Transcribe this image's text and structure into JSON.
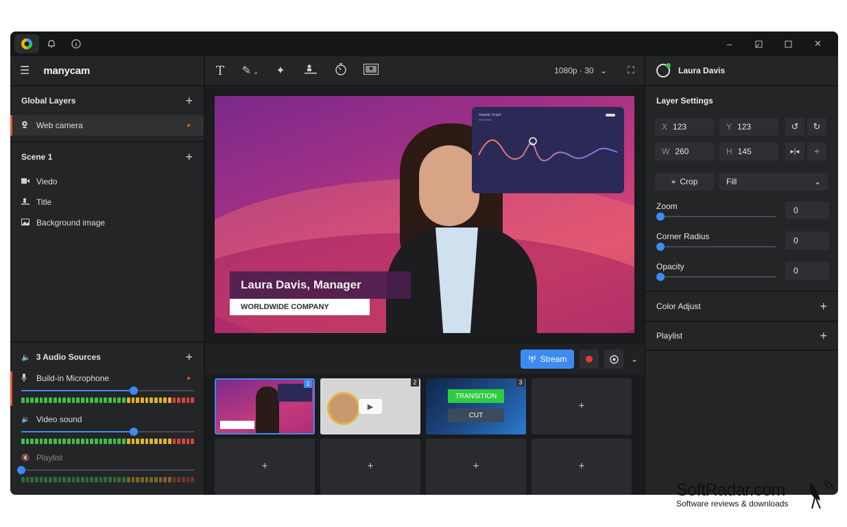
{
  "app": {
    "brand": "manycam"
  },
  "left": {
    "global_layers_title": "Global Layers",
    "global_layers": [
      {
        "label": "Web camera",
        "icon": "webcam-icon"
      }
    ],
    "scene_title": "Scene 1",
    "scene_layers": [
      {
        "label": "Viedo",
        "icon": "video-icon"
      },
      {
        "label": "Title",
        "icon": "title-icon"
      },
      {
        "label": "Background image",
        "icon": "image-icon"
      }
    ],
    "audio_title": "3 Audio Sources",
    "audio_sources": [
      {
        "label": "Build-in Microphone",
        "level": 0.65
      },
      {
        "label": "Video sound",
        "level": 0.65
      },
      {
        "label": "Playlist",
        "level": 0.0
      }
    ]
  },
  "toolbar": {
    "resolution": "1080p · 30"
  },
  "preview": {
    "lower_third_name": "Laura Davis, Manager",
    "lower_third_company": "WORLDWIDE COMPANY",
    "graph_title": "Statistic Graph",
    "graph_subtitle": "description"
  },
  "stream": {
    "stream_label": "Stream"
  },
  "scenes": {
    "numbers": [
      "1",
      "2",
      "3"
    ],
    "transition_label": "TRANSITION",
    "cut_label": "CUT",
    "add": "+"
  },
  "right": {
    "user_name": "Laura Davis",
    "layer_settings_title": "Layer Settings",
    "x_label": "X",
    "x_value": "123",
    "y_label": "Y",
    "y_value": "123",
    "w_label": "W",
    "w_value": "260",
    "h_label": "H",
    "h_value": "145",
    "crop_label": "Crop",
    "fill_label": "Fill",
    "zoom_label": "Zoom",
    "zoom_value": "0",
    "corner_label": "Corner Radius",
    "corner_value": "0",
    "opacity_label": "Opacity",
    "opacity_value": "0",
    "color_adjust_label": "Color Adjust",
    "playlist_label": "Playlist"
  },
  "watermark": {
    "title": "SoftRadar.com",
    "subtitle": "Software reviews & downloads"
  },
  "colors": {
    "accent": "#3d8bf2",
    "record": "#e03c32",
    "active_marker": "#e8542e",
    "transition": "#2ecc40"
  }
}
